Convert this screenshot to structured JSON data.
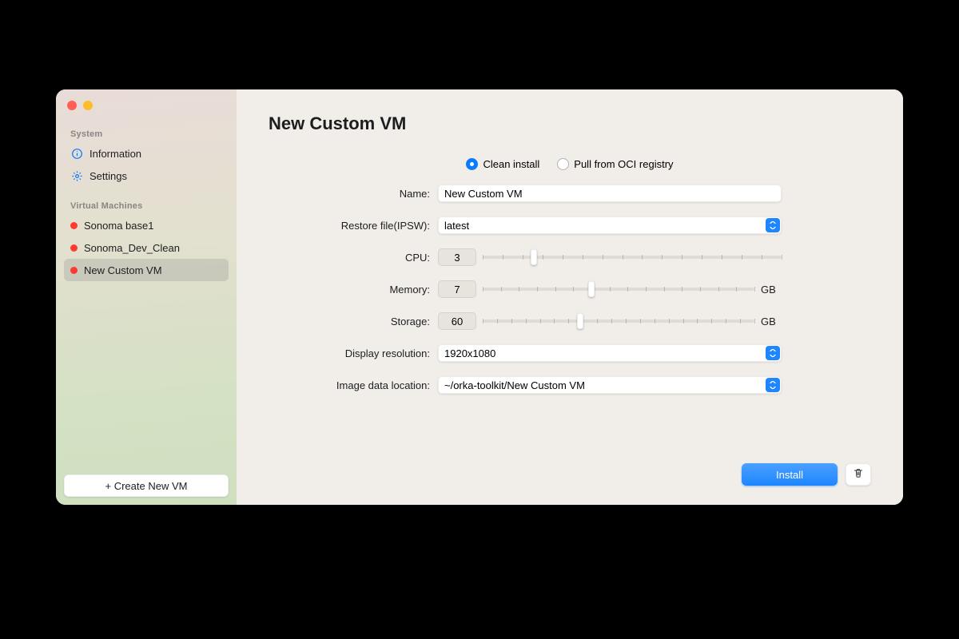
{
  "sidebar": {
    "system_label": "System",
    "information": "Information",
    "settings": "Settings",
    "vm_label": "Virtual Machines",
    "vms": [
      "Sonoma base1",
      "Sonoma_Dev_Clean",
      "New Custom VM"
    ],
    "selected_vm_index": 2,
    "create_button": "+ Create New VM"
  },
  "main": {
    "title": "New Custom VM",
    "install_mode": {
      "clean": "Clean install",
      "oci": "Pull from OCI registry",
      "selected": "clean"
    },
    "form": {
      "name_label": "Name:",
      "name_value": "New Custom VM",
      "restore_label": "Restore file(IPSW):",
      "restore_value": "latest",
      "cpu_label": "CPU:",
      "cpu_value": "3",
      "cpu_min": 1,
      "cpu_max": 16,
      "cpu_ticks": 16,
      "cpu_pos": 0.17,
      "memory_label": "Memory:",
      "memory_value": "7",
      "memory_unit": "GB",
      "memory_min": 1,
      "memory_max": 16,
      "memory_ticks": 16,
      "memory_pos": 0.4,
      "storage_label": "Storage:",
      "storage_value": "60",
      "storage_unit": "GB",
      "storage_min": 10,
      "storage_max": 200,
      "storage_ticks": 20,
      "storage_pos": 0.36,
      "display_label": "Display resolution:",
      "display_value": "1920x1080",
      "image_label": "Image data location:",
      "image_value": "~/orka-toolkit/New Custom VM"
    },
    "install_button": "Install"
  },
  "colors": {
    "accent": "#1e86ff",
    "status_red": "#ff3b30"
  }
}
